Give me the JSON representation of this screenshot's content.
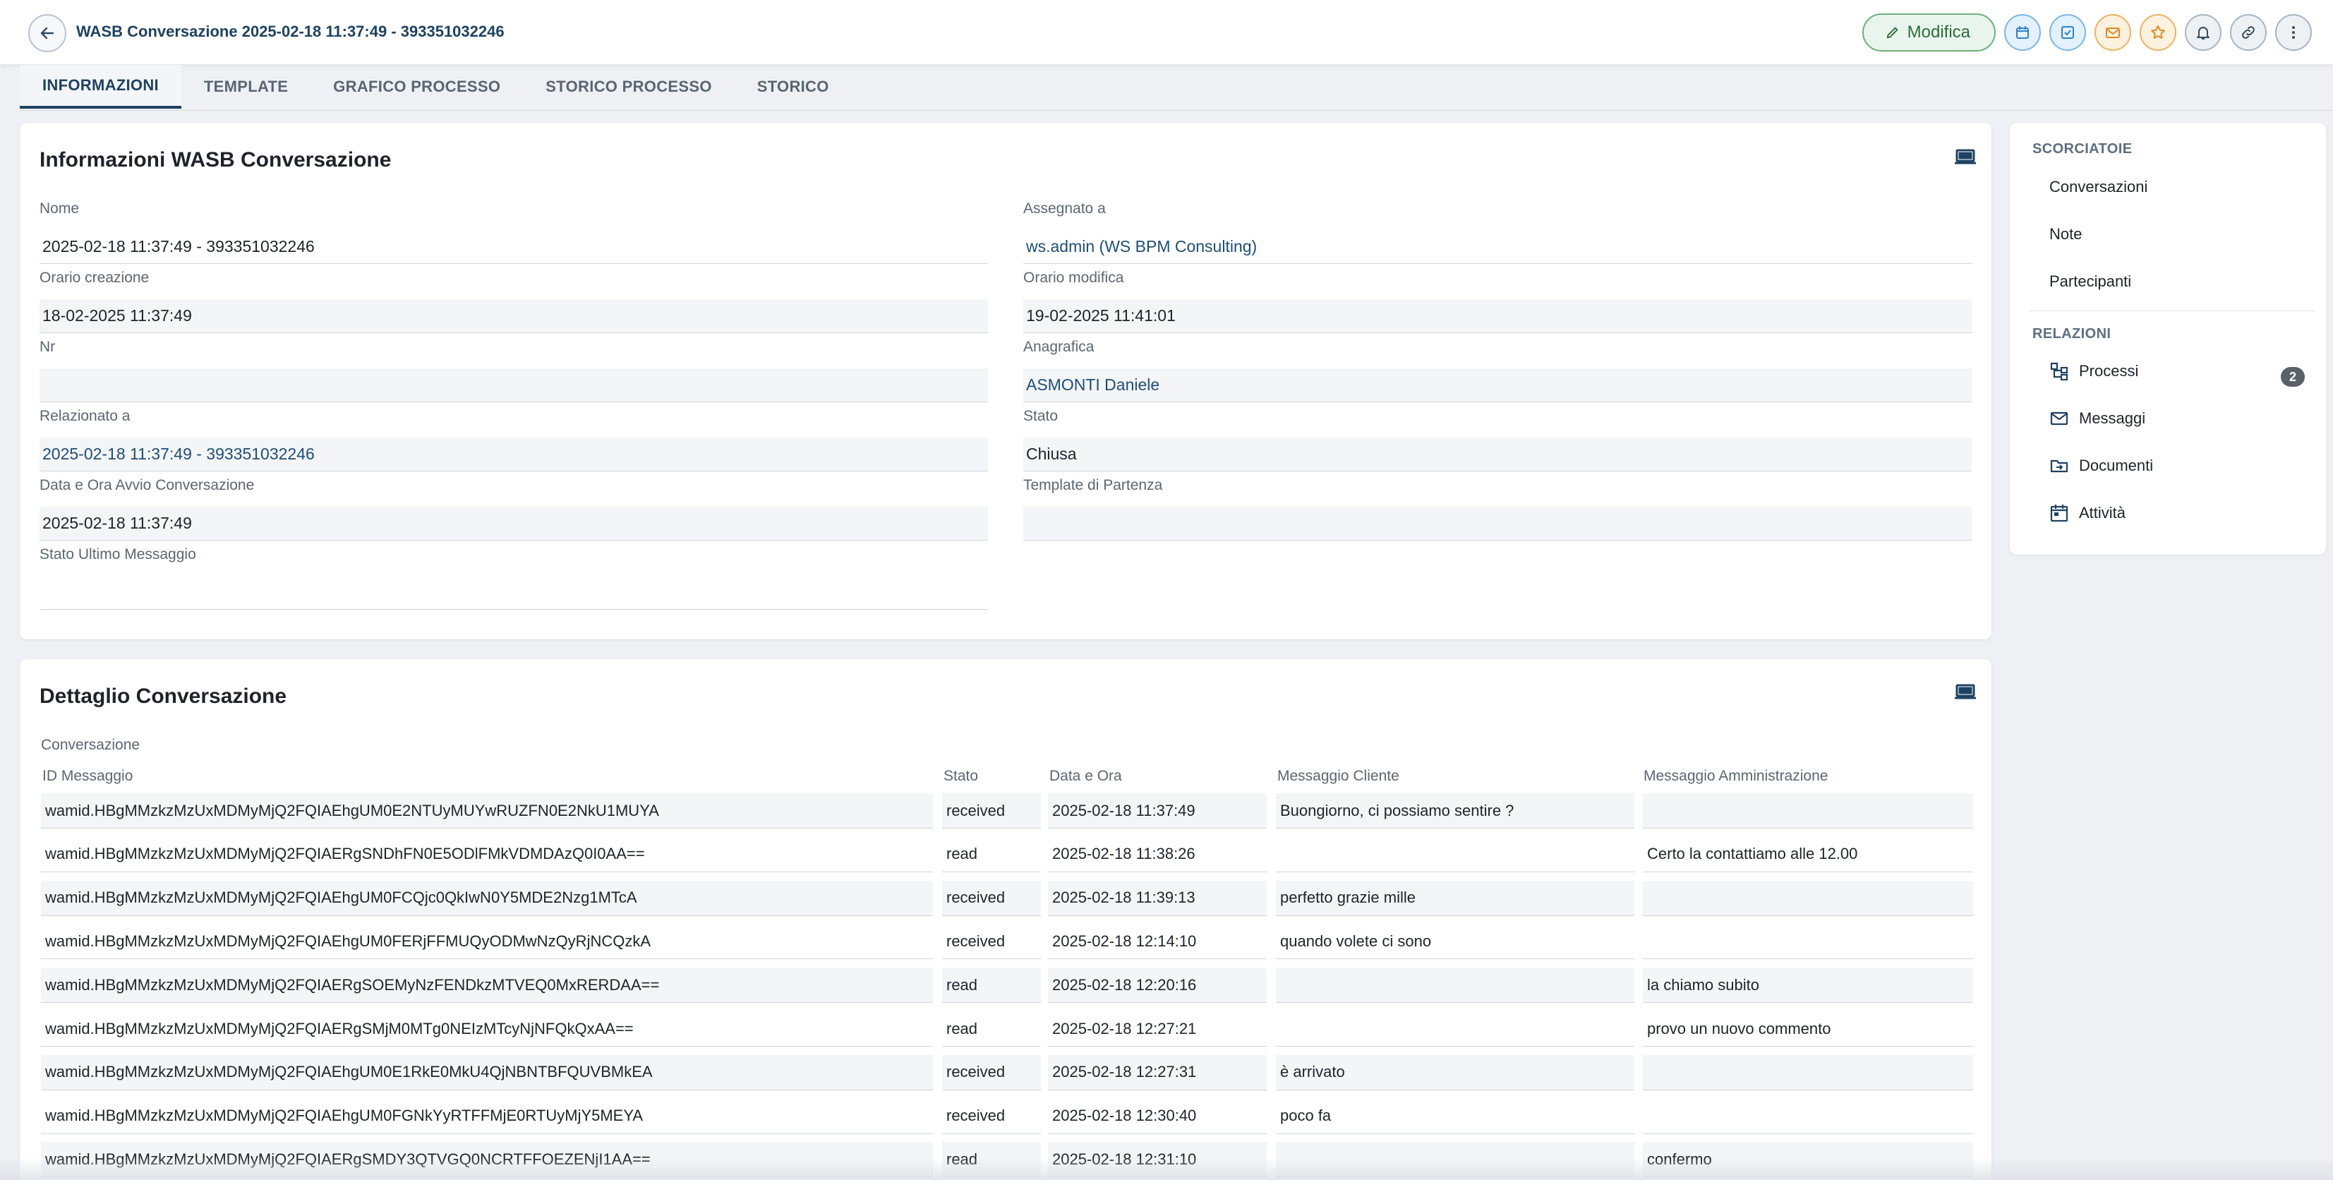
{
  "header": {
    "title": "WASB Conversazione 2025-02-18 11:37:49 - 393351032246",
    "edit_label": "Modifica",
    "action_icons": [
      "calendar-icon",
      "checkbox-icon",
      "mail-icon",
      "star-icon",
      "bell-icon",
      "link-icon",
      "more-vertical-icon"
    ]
  },
  "tabs": [
    "INFORMAZIONI",
    "TEMPLATE",
    "GRAFICO PROCESSO",
    "STORICO PROCESSO",
    "STORICO"
  ],
  "info": {
    "title": "Informazioni WASB Conversazione",
    "left": [
      {
        "label": "Nome",
        "value": "2025-02-18 11:37:49 - 393351032246"
      },
      {
        "label": "Orario creazione",
        "value": "18-02-2025 11:37:49"
      },
      {
        "label": "Nr",
        "value": ""
      },
      {
        "label": "Relazionato a",
        "value": "2025-02-18 11:37:49 - 393351032246"
      },
      {
        "label": "Data e Ora Avvio Conversazione",
        "value": "2025-02-18 11:37:49"
      },
      {
        "label": "Stato Ultimo Messaggio",
        "value": ""
      }
    ],
    "right": [
      {
        "label": "Assegnato a",
        "value": "ws.admin (WS BPM Consulting)"
      },
      {
        "label": "Orario modifica",
        "value": "19-02-2025 11:41:01"
      },
      {
        "label": "Anagrafica",
        "value": "ASMONTI Daniele"
      },
      {
        "label": "Stato",
        "value": "Chiusa"
      },
      {
        "label": "Template di Partenza",
        "value": ""
      }
    ]
  },
  "sidebar": {
    "shortcuts_title": "SCORCIATOIE",
    "shortcuts": [
      "Conversazioni",
      "Note",
      "Partecipanti"
    ],
    "relations_title": "RELAZIONI",
    "relations": [
      {
        "label": "Processi",
        "badge": "2",
        "icon": "process-tree-icon"
      },
      {
        "label": "Messaggi",
        "icon": "mail-icon"
      },
      {
        "label": "Documenti",
        "icon": "folder-icon"
      },
      {
        "label": "Attività",
        "icon": "calendar-icon"
      }
    ]
  },
  "detail": {
    "title": "Dettaglio Conversazione",
    "section_label": "Conversazione",
    "columns": [
      "ID Messaggio",
      "Stato",
      "Data e Ora",
      "Messaggio Cliente",
      "Messaggio Amministrazione"
    ],
    "rows": [
      [
        "wamid.HBgMMzkzMzUxMDMyMjQ2FQIAEhgUM0E2NTUyMUYwRUZFN0E2NkU1MUYA",
        "received",
        "2025-02-18 11:37:49",
        "Buongiorno, ci possiamo sentire ?",
        ""
      ],
      [
        "wamid.HBgMMzkzMzUxMDMyMjQ2FQIAERgSNDhFN0E5ODlFMkVDMDAzQ0I0AA==",
        "read",
        "2025-02-18 11:38:26",
        "",
        "Certo la contattiamo alle 12.00"
      ],
      [
        "wamid.HBgMMzkzMzUxMDMyMjQ2FQIAEhgUM0FCQjc0QkIwN0Y5MDE2Nzg1MTcA",
        "received",
        "2025-02-18 11:39:13",
        "perfetto grazie mille",
        ""
      ],
      [
        "wamid.HBgMMzkzMzUxMDMyMjQ2FQIAEhgUM0FERjFFMUQyODMwNzQyRjNCQzkA",
        "received",
        "2025-02-18 12:14:10",
        "quando volete ci sono",
        ""
      ],
      [
        "wamid.HBgMMzkzMzUxMDMyMjQ2FQIAERgSOEMyNzFENDkzMTVEQ0MxRERDAA==",
        "read",
        "2025-02-18 12:20:16",
        "",
        "la chiamo subito"
      ],
      [
        "wamid.HBgMMzkzMzUxMDMyMjQ2FQIAERgSMjM0MTg0NEIzMTcyNjNFQkQxAA==",
        "read",
        "2025-02-18 12:27:21",
        "",
        "provo un nuovo commento"
      ],
      [
        "wamid.HBgMMzkzMzUxMDMyMjQ2FQIAEhgUM0E1RkE0MkU4QjNBNTBFQUVBMkEA",
        "received",
        "2025-02-18 12:27:31",
        "è arrivato",
        ""
      ],
      [
        "wamid.HBgMMzkzMzUxMDMyMjQ2FQIAEhgUM0FGNkYyRTFFMjE0RTUyMjY5MEYA",
        "received",
        "2025-02-18 12:30:40",
        "poco fa",
        ""
      ],
      [
        "wamid.HBgMMzkzMzUxMDMyMjQ2FQIAERgSMDY3QTVGQ0NCRTFFOEZENjI1AA==",
        "read",
        "2025-02-18 12:31:10",
        "",
        "confermo"
      ]
    ]
  }
}
